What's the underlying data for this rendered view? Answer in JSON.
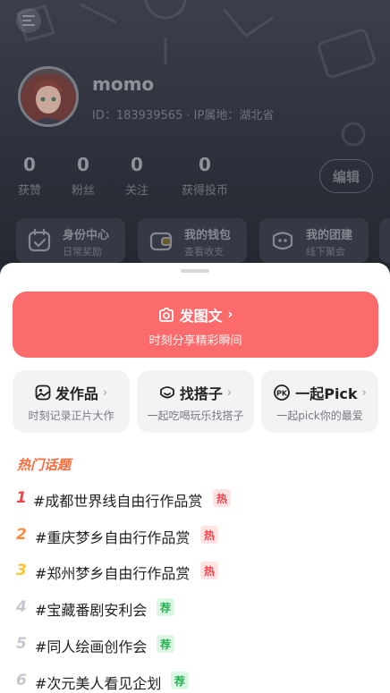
{
  "profile": {
    "username": "momo",
    "info": "ID：183939565 · IP属地：湖北省",
    "edit_label": "编辑",
    "stats": [
      {
        "num": "0",
        "label": "获赞"
      },
      {
        "num": "0",
        "label": "粉丝"
      },
      {
        "num": "0",
        "label": "关注"
      },
      {
        "num": "0",
        "label": "获得投币"
      }
    ],
    "quick_cards": [
      {
        "title": "身份中心",
        "sub": "日常奖励",
        "icon": "calendar-icon"
      },
      {
        "title": "我的钱包",
        "sub": "查看收支",
        "icon": "wallet-icon"
      },
      {
        "title": "我的团建",
        "sub": "线下聚会",
        "icon": "group-face-icon"
      }
    ]
  },
  "sheet": {
    "primary": {
      "title": "发图文",
      "sub": "时刻分享精彩瞬间",
      "icon": "camera-icon"
    },
    "actions": [
      {
        "title": "发作品",
        "sub": "时刻记录正片大作",
        "icon": "image-icon"
      },
      {
        "title": "找搭子",
        "sub": "一起吃喝玩乐找搭子",
        "icon": "smile-icon"
      },
      {
        "title": "一起Pick",
        "sub": "一起pick你的最爱",
        "icon": "pk-icon"
      }
    ],
    "topics_title": "热门话题",
    "topics": [
      {
        "rank": "1",
        "name": "#成都世界线自由行作品赏",
        "badge": "热",
        "type": "hot"
      },
      {
        "rank": "2",
        "name": "#重庆梦乡自由行作品赏",
        "badge": "热",
        "type": "hot"
      },
      {
        "rank": "3",
        "name": "#郑州梦乡自由行作品赏",
        "badge": "热",
        "type": "hot"
      },
      {
        "rank": "4",
        "name": "#宝藏番剧安利会",
        "badge": "荐",
        "type": "rec"
      },
      {
        "rank": "5",
        "name": "#同人绘画创作会",
        "badge": "荐",
        "type": "rec"
      },
      {
        "rank": "6",
        "name": "#次元美人看见企划",
        "badge": "荐",
        "type": "rec"
      }
    ]
  },
  "colors": {
    "accent": "#fb6b6b",
    "rank1": "#f2434c",
    "rank2": "#fb8a3c",
    "rank3": "#f7c531",
    "rank_other": "#c5c7cc"
  }
}
